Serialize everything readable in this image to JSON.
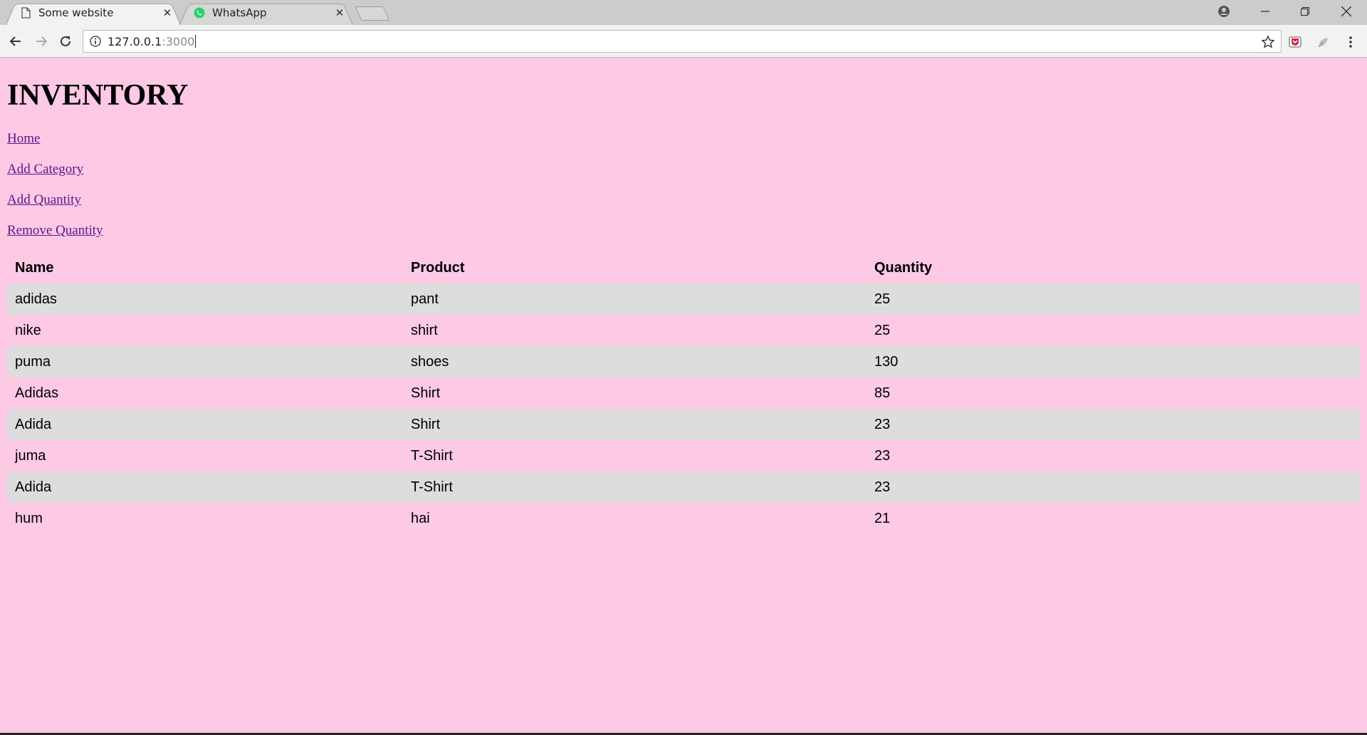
{
  "browser": {
    "tabs": [
      {
        "title": "Some website",
        "favicon": "page-icon",
        "active": true
      },
      {
        "title": "WhatsApp",
        "favicon": "whatsapp-icon",
        "active": false
      }
    ],
    "url": {
      "host": "127.0.0.1",
      "port": ":3000"
    },
    "whatsapp_color": "#25d366"
  },
  "page": {
    "heading": "INVENTORY",
    "links": [
      "Home",
      "Add Category",
      "Add Quantity",
      "Remove Quantity"
    ],
    "background": "#fdc9e4",
    "stripe_color": "#dddddd",
    "link_color": "#551a8b",
    "table": {
      "headers": [
        "Name",
        "Product",
        "Quantity"
      ],
      "rows": [
        [
          "adidas",
          "pant",
          "25"
        ],
        [
          "nike",
          "shirt",
          "25"
        ],
        [
          "puma",
          "shoes",
          "130"
        ],
        [
          "Adidas",
          "Shirt",
          "85"
        ],
        [
          "Adida",
          "Shirt",
          "23"
        ],
        [
          "juma",
          "T-Shirt",
          "23"
        ],
        [
          "Adida",
          "T-Shirt",
          "23"
        ],
        [
          "hum",
          "hai",
          "21"
        ]
      ]
    }
  }
}
